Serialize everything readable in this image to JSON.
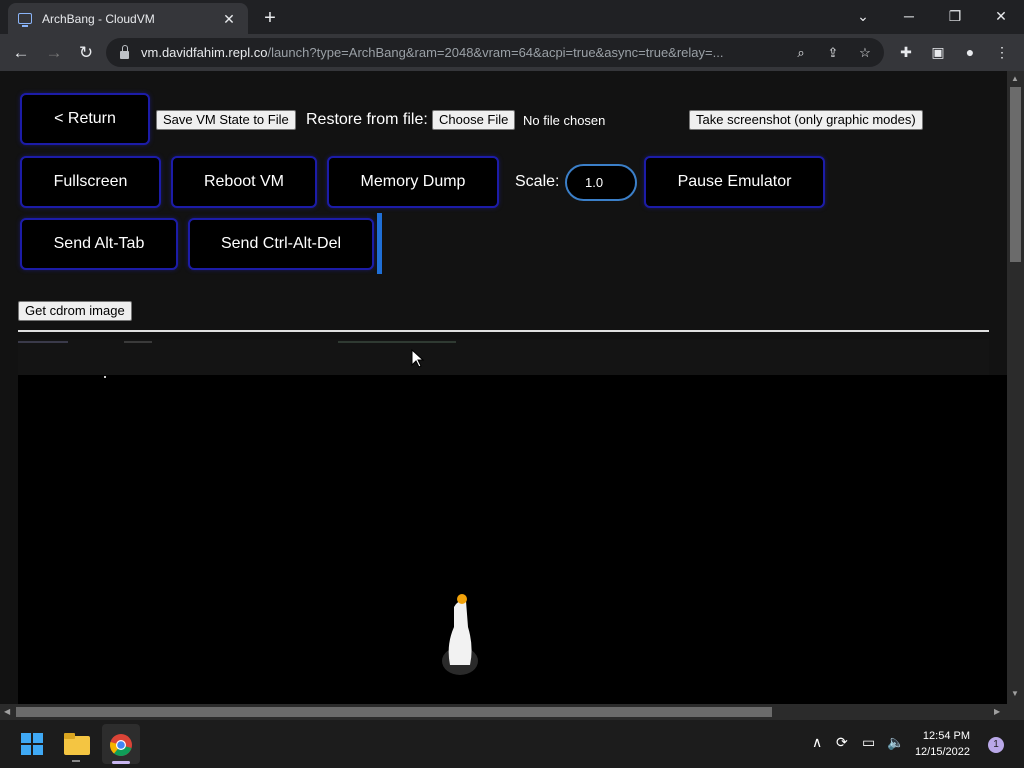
{
  "browser": {
    "tab_title": "ArchBang - CloudVM",
    "tab_close": "✕",
    "new_tab": "+",
    "url_host": "vm.davidfahim.repl.co",
    "url_path": "/launch?type=ArchBang&ram=2048&vram=64&acpi=true&async=true&relay=..."
  },
  "controls": {
    "return_label": "< Return",
    "save_state_label": "Save VM State to File",
    "restore_label": "Restore from file:",
    "choose_file_label": "Choose File",
    "no_file_label": "No file chosen",
    "screenshot_label": "Take screenshot (only graphic modes)",
    "fullscreen_label": "Fullscreen",
    "reboot_label": "Reboot VM",
    "memory_dump_label": "Memory Dump",
    "scale_label": "Scale:",
    "scale_value": "1.0",
    "pause_label": "Pause Emulator",
    "alt_tab_label": "Send Alt-Tab",
    "ctrl_alt_del_label": "Send Ctrl-Alt-Del",
    "cdrom_label": "Get cdrom image"
  },
  "taskbar": {
    "time": "12:54 PM",
    "date": "12/15/2022",
    "notification_count": "1"
  },
  "colors": {
    "button_border": "#1c1ca8",
    "scale_border": "#3b7fc8",
    "accent_bar": "#1f6fd6"
  }
}
